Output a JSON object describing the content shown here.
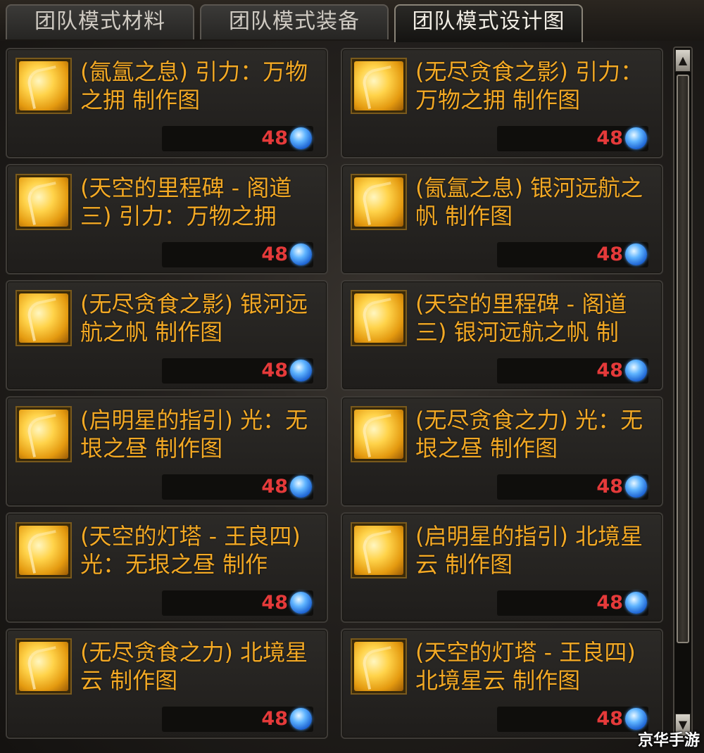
{
  "tabs": [
    {
      "label": "团队模式材料",
      "active": false
    },
    {
      "label": "团队模式装备",
      "active": false
    },
    {
      "label": "团队模式设计图",
      "active": true
    }
  ],
  "currency_icon": "blue-gem-icon",
  "items": [
    {
      "name": "(氤氲之息) 引力：万物之拥 制作图",
      "price": "48"
    },
    {
      "name": "(无尽贪食之影) 引力：万物之拥 制作图",
      "price": "48"
    },
    {
      "name": "(天空的里程碑 - 阁道三) 引力：万物之拥",
      "price": "48"
    },
    {
      "name": "(氤氲之息) 银河远航之帆 制作图",
      "price": "48"
    },
    {
      "name": "(无尽贪食之影) 银河远航之帆 制作图",
      "price": "48"
    },
    {
      "name": "(天空的里程碑 - 阁道三) 银河远航之帆 制",
      "price": "48"
    },
    {
      "name": "(启明星的指引) 光：无垠之昼 制作图",
      "price": "48"
    },
    {
      "name": "(无尽贪食之力) 光：无垠之昼 制作图",
      "price": "48"
    },
    {
      "name": "(天空的灯塔 - 王良四) 光：无垠之昼 制作",
      "price": "48"
    },
    {
      "name": "(启明星的指引) 北境星云 制作图",
      "price": "48"
    },
    {
      "name": "(无尽贪食之力) 北境星云 制作图",
      "price": "48"
    },
    {
      "name": "(天空的灯塔 - 王良四) 北境星云 制作图",
      "price": "48"
    }
  ],
  "scrollbar": {
    "up_glyph": "▲",
    "down_glyph": "▼"
  },
  "watermark": "京华手游",
  "colors": {
    "item_name": "#f3a925",
    "price": "#e53a3a",
    "background": "#1a1714"
  }
}
